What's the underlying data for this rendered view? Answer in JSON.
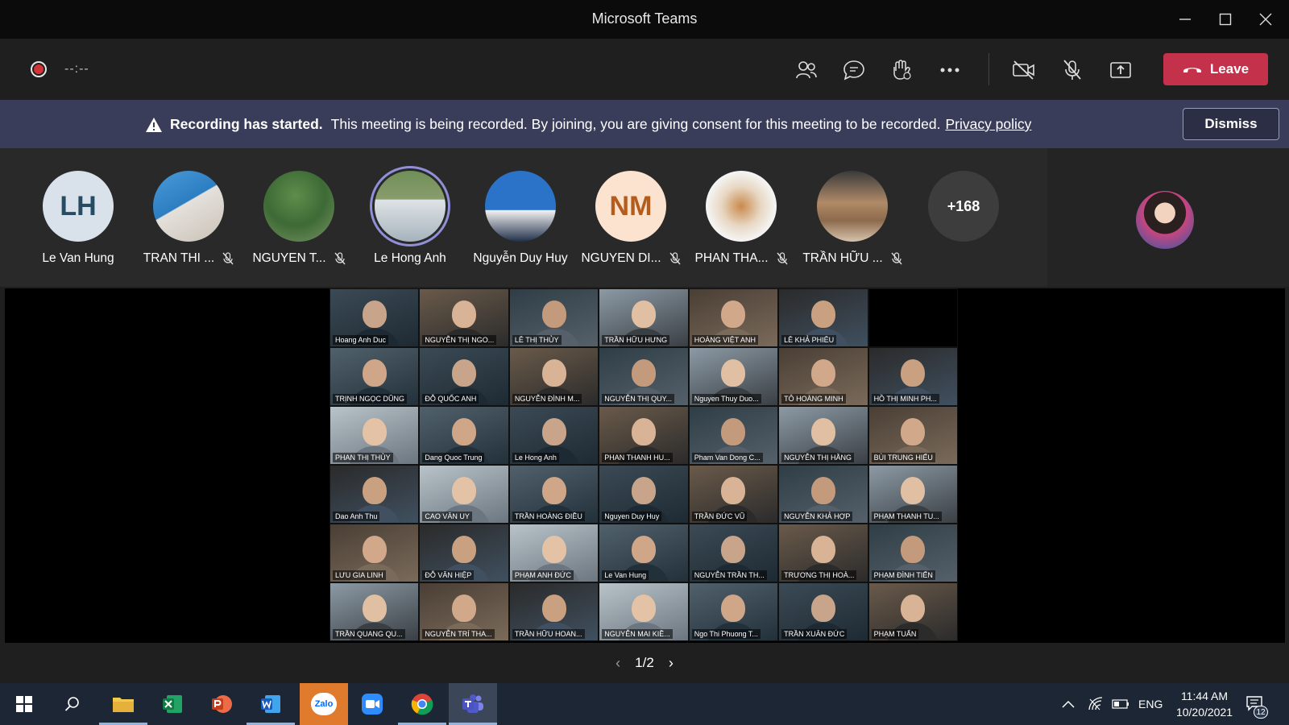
{
  "window": {
    "title": "Microsoft Teams"
  },
  "toolbar": {
    "timer": "--:--",
    "leave_label": "Leave",
    "icons": [
      "people-icon",
      "chat-icon",
      "raise-hand-icon",
      "more-icon",
      "camera-off-icon",
      "mic-off-icon",
      "share-icon"
    ]
  },
  "banner": {
    "title": "Recording has started.",
    "message": "This meeting is being recorded. By joining, you are giving consent for this meeting to be recorded.",
    "link": "Privacy policy",
    "dismiss_label": "Dismiss"
  },
  "participants": [
    {
      "name": "Le Van Hung",
      "initials": "LH",
      "muted": false
    },
    {
      "name": "TRAN THI ...",
      "muted": true
    },
    {
      "name": "NGUYEN T...",
      "muted": true
    },
    {
      "name": "Le Hong Anh",
      "muted": false,
      "speaking": true
    },
    {
      "name": "Nguyễn Duy Huy",
      "muted": false
    },
    {
      "name": "NGUYEN DI...",
      "initials": "NM",
      "muted": true
    },
    {
      "name": "PHAN THA...",
      "muted": true
    },
    {
      "name": "TRẦN HỮU ...",
      "muted": true
    }
  ],
  "overflow_count": "+168",
  "grid_tiles": [
    "Hoang Anh Duc",
    "NGUYỄN THỊ NGO...",
    "LÊ THỊ THỦY",
    "TRẦN HỮU HƯNG",
    "HOÀNG VIỆT ANH",
    "LÊ KHẢ PHIÊU",
    "",
    "TRỊNH NGỌC DŨNG",
    "ĐỖ QUỐC ANH",
    "NGUYỄN ĐÌNH M...",
    "NGUYỄN THỊ QUY...",
    "Nguyen Thuy Duo...",
    "TÔ HOÀNG MINH",
    "HỒ THỊ MINH PH...",
    "PHAN THỊ THỦY",
    "Dang Quoc Trung",
    "Le Hong Anh",
    "PHAN THANH HU...",
    "Pham Van Dong C...",
    "NGUYỄN THỊ HẰNG",
    "BÙI TRUNG HIẾU",
    "Dao Anh Thu",
    "CAO VĂN UY",
    "TRẦN HOÀNG ĐIỀU",
    "Nguyen Duy Huy",
    "TRẦN ĐỨC VŨ",
    "NGUYỄN KHẢ HỢP",
    "PHẠM THANH TU...",
    "LƯU GIA LINH",
    "ĐỖ VĂN HIỆP",
    "PHẠM ANH ĐỨC",
    "Le Van Hung",
    "NGUYỄN TRẦN TH...",
    "TRƯƠNG THỊ HOÀ...",
    "PHẠM ĐÌNH TIẾN",
    "TRẦN QUANG QU...",
    "NGUYỄN TRÍ THA...",
    "TRẦN HỮU HOAN...",
    "NGUYỄN MAI KIỀ...",
    "Ngo Thi Phuong T...",
    "TRẦN XUÂN ĐỨC",
    "PHẠM TUẤN"
  ],
  "pager": {
    "label": "1/2"
  },
  "taskbar": {
    "apps": [
      "file-explorer",
      "excel",
      "powerpoint",
      "word",
      "zalo",
      "zoom",
      "chrome",
      "teams"
    ],
    "zalo_label": "Zalo",
    "language": "ENG",
    "time": "11:44 AM",
    "date": "10/20/2021",
    "notification_count": "12"
  }
}
